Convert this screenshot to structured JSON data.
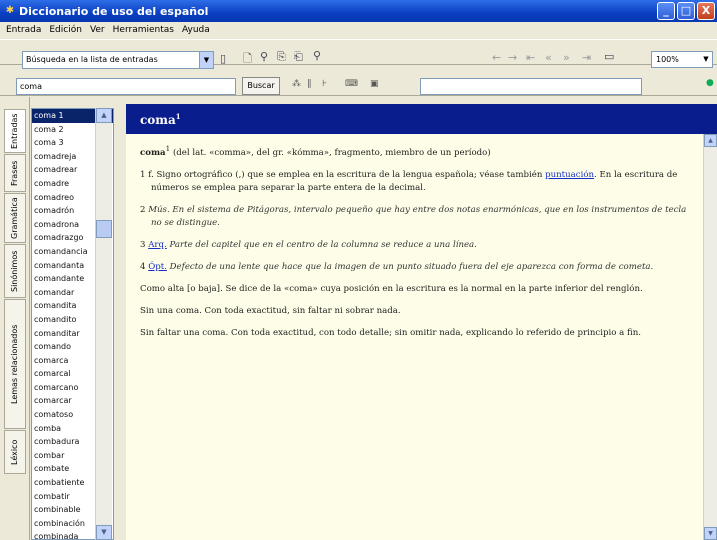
{
  "window": {
    "title": "Diccionario de uso del español",
    "min": "_",
    "max": "□",
    "close": "X"
  },
  "menu": [
    "Entrada",
    "Edición",
    "Ver",
    "Herramientas",
    "Ayuda"
  ],
  "toolbar": {
    "search_mode": "Búsqueda en la lista de entradas",
    "zoom": "100%"
  },
  "search": {
    "value": "coma",
    "button": "Buscar"
  },
  "left_tabs": [
    "Entradas",
    "Frases",
    "Gramática",
    "Sinónimos",
    "Lemas relacionados",
    "Léxico"
  ],
  "entries": [
    "coma 1",
    "coma 2",
    "coma 3",
    "comadreja",
    "comadrear",
    "comadre",
    "comadreo",
    "comadrón",
    "comadrona",
    "comadrazgo",
    "comandancia",
    "comandanta",
    "comandante",
    "comandar",
    "comandita",
    "comandito",
    "comanditar",
    "comando",
    "comarca",
    "comarcal",
    "comarcano",
    "comarcar",
    "comatoso",
    "comba",
    "combadura",
    "combar",
    "combate",
    "combatiente",
    "combatir",
    "combinable",
    "combinación",
    "combinada"
  ],
  "article": {
    "heading": "coma",
    "heading_sup": "1",
    "lemma": "coma",
    "lemma_sup": "1",
    "intro": "(del lat. «comma», del gr. «kómma», fragmento, miembro de un período)",
    "senses": [
      {
        "num": "1",
        "text": "f. Signo ortográfico (,) que se emplea en la escritura de la lengua española; véase también",
        "link": "puntuación",
        "text2": "En la escritura de números se emplea para separar la parte entera de la decimal."
      },
      {
        "num": "2",
        "text": "Mús. En el sistema de Pitágoras, intervalo pequeño que hay entre dos notas enarmónicas, que en los instrumentos de tecla no se distingue."
      },
      {
        "num": "3",
        "tag": "Arq.",
        "text": "Parte del capitel que en el centro de la columna se reduce a una línea."
      },
      {
        "num": "4",
        "tag": "Ópt.",
        "text": "Defecto de una lente que hace que la imagen de un punto situado fuera del eje aparezca con forma de cometa."
      }
    ],
    "phrases": [
      "Como alta [o baja]. Se dice de la «coma» cuya posición en la escritura es la normal en la parte inferior del renglón.",
      "Sin una coma. Con toda exactitud, sin faltar ni sobrar nada.",
      "Sin faltar una coma. Con toda exactitud, con todo detalle; sin omitir nada, explicando lo referido de principio a fin."
    ]
  },
  "colors": {
    "header": "#0A1D8C",
    "content_bg": "#FDFDE8",
    "selected": "#0A246A",
    "link": "#1530C8"
  }
}
